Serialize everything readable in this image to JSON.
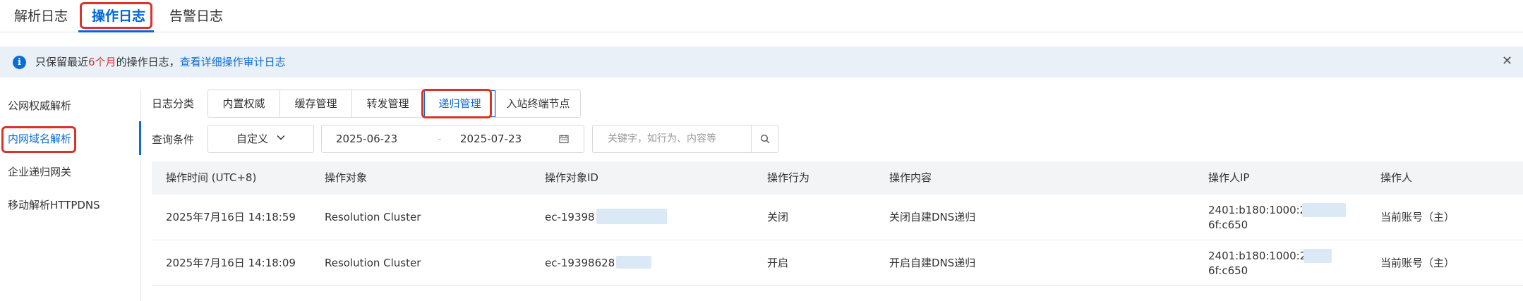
{
  "top_tabs": [
    "解析日志",
    "操作日志",
    "告警日志"
  ],
  "notice": {
    "prefix": "只保留最近",
    "highlight": "6个月",
    "suffix": "的操作日志，",
    "link": "查看详细操作审计日志"
  },
  "sidebar": {
    "items": [
      "公网权威解析",
      "内网域名解析",
      "企业递归网关",
      "移动解析HTTPDNS"
    ]
  },
  "filters": {
    "category_label": "日志分类",
    "categories": [
      "内置权威",
      "缓存管理",
      "转发管理",
      "递归管理",
      "入站终端节点"
    ],
    "query_label": "查询条件",
    "dropdown_value": "自定义",
    "date_start": "2025-06-23",
    "date_separator": "-",
    "date_end": "2025-07-23",
    "search_placeholder": "关键字，如行为、内容等"
  },
  "table": {
    "columns": [
      "操作时间 (UTC+8)",
      "操作对象",
      "操作对象ID",
      "操作行为",
      "操作内容",
      "操作人IP",
      "操作人"
    ],
    "rows": [
      [
        "2025年7月16日 14:18:59",
        "Resolution Cluster",
        "ec-19398",
        "关闭",
        "关闭自建DNS递归",
        "2401:b180:1000:2:d",
        "6f:c650",
        "当前账号（主）"
      ],
      [
        "2025年7月16日 14:18:09",
        "Resolution Cluster",
        "ec-19398628",
        "开启",
        "开启自建DNS递归",
        "2401:b180:1000:2",
        "6f:c650",
        "当前账号（主）"
      ]
    ]
  },
  "colors": {
    "accent": "#0b6cd8",
    "highlight_red": "#d9332a",
    "notice_bg": "#e9f0f8",
    "header_bg": "#f2f4f6"
  }
}
